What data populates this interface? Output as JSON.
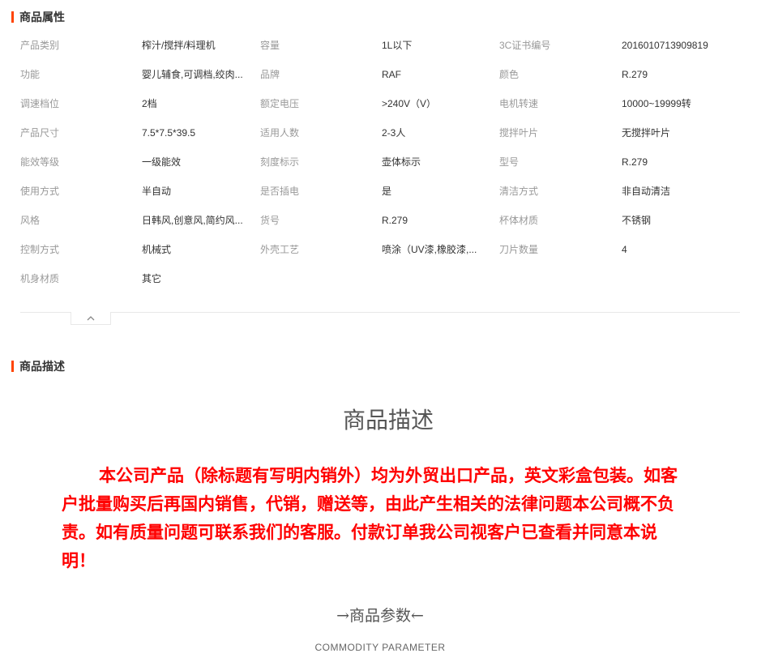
{
  "sections": {
    "attributes_title": "商品属性",
    "description_title": "商品描述"
  },
  "attributes": [
    [
      {
        "k": "产品类别",
        "v": "榨汁/搅拌/料理机"
      },
      {
        "k": "容量",
        "v": "1L以下"
      },
      {
        "k": "3C证书编号",
        "v": "2016010713909819"
      }
    ],
    [
      {
        "k": "功能",
        "v": "婴儿辅食,可调档,绞肉..."
      },
      {
        "k": "品牌",
        "v": "RAF"
      },
      {
        "k": "颜色",
        "v": "R.279"
      }
    ],
    [
      {
        "k": "调速档位",
        "v": "2档"
      },
      {
        "k": "额定电压",
        "v": ">240V（V）"
      },
      {
        "k": "电机转速",
        "v": "10000~19999转"
      }
    ],
    [
      {
        "k": "产品尺寸",
        "v": "7.5*7.5*39.5"
      },
      {
        "k": "适用人数",
        "v": "2-3人"
      },
      {
        "k": "搅拌叶片",
        "v": "无搅拌叶片"
      }
    ],
    [
      {
        "k": "能效等级",
        "v": "一级能效"
      },
      {
        "k": "刻度标示",
        "v": "壶体标示"
      },
      {
        "k": "型号",
        "v": "R.279"
      }
    ],
    [
      {
        "k": "使用方式",
        "v": "半自动"
      },
      {
        "k": "是否插电",
        "v": "是"
      },
      {
        "k": "清洁方式",
        "v": "非自动清洁"
      }
    ],
    [
      {
        "k": "风格",
        "v": "日韩风,创意风,简约风..."
      },
      {
        "k": "货号",
        "v": "R.279"
      },
      {
        "k": "杯体材质",
        "v": "不锈钢"
      }
    ],
    [
      {
        "k": "控制方式",
        "v": "机械式"
      },
      {
        "k": "外壳工艺",
        "v": "喷涂（UV漆,橡胶漆,..."
      },
      {
        "k": "刀片数量",
        "v": "4"
      }
    ],
    [
      {
        "k": "机身材质",
        "v": "其它"
      }
    ]
  ],
  "collapse_icon": "chevron-up-icon",
  "description": {
    "heading": "商品描述",
    "notice": "本公司产品（除标题有写明内销外）均为外贸出口产品，英文彩盒包装。如客户批量购买后再国内销售，代销，赠送等，由此产生相关的法律问题本公司概不负责。如有质量问题可联系我们的客服。付款订单我公司视客户已查看并同意本说明！",
    "param_heading": "→商品参数←",
    "param_sub": "COMMODITY  PARAMETER"
  },
  "colors": {
    "accent": "#ff4400",
    "notice": "#ff0000"
  }
}
